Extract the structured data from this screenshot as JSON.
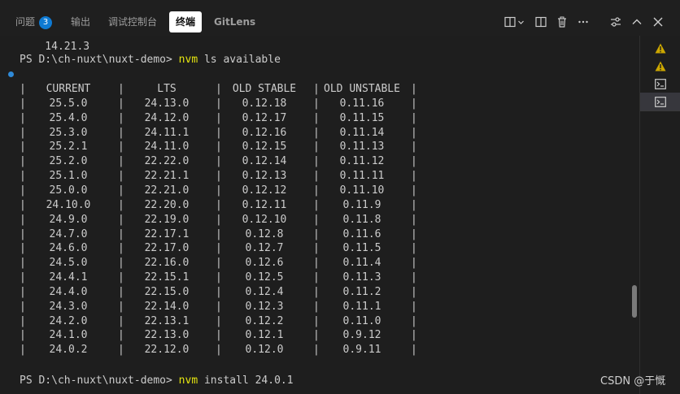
{
  "tabs": [
    {
      "label": "问题",
      "badge": "3"
    },
    {
      "label": "输出"
    },
    {
      "label": "调试控制台"
    },
    {
      "label": "终端",
      "active": true
    },
    {
      "label": "GitLens"
    }
  ],
  "toolbar_icons": [
    "split-terminal-icon",
    "chevron-down-icon",
    "layout-icon",
    "trash-icon",
    "more-icon",
    "settings-icon",
    "maximize-chevron-up-icon",
    "close-icon"
  ],
  "terminal": {
    "line_version": "    14.21.3",
    "prompt1": "PS D:\\ch-nuxt\\nuxt-demo> ",
    "cmd1": "nvm",
    "args1": " ls available",
    "prompt2": "PS D:\\ch-nuxt\\nuxt-demo> ",
    "cmd2": "nvm",
    "args2": " install 24.0.1"
  },
  "table": {
    "headers": [
      "CURRENT",
      "LTS",
      "OLD STABLE",
      "OLD UNSTABLE"
    ],
    "rows": [
      [
        "25.5.0",
        "24.13.0",
        "0.12.18",
        "0.11.16"
      ],
      [
        "25.4.0",
        "24.12.0",
        "0.12.17",
        "0.11.15"
      ],
      [
        "25.3.0",
        "24.11.1",
        "0.12.16",
        "0.11.14"
      ],
      [
        "25.2.1",
        "24.11.0",
        "0.12.15",
        "0.11.13"
      ],
      [
        "25.2.0",
        "22.22.0",
        "0.12.14",
        "0.11.12"
      ],
      [
        "25.1.0",
        "22.21.1",
        "0.12.13",
        "0.11.11"
      ],
      [
        "25.0.0",
        "22.21.0",
        "0.12.12",
        "0.11.10"
      ],
      [
        "24.10.0",
        "22.20.0",
        "0.12.11",
        "0.11.9"
      ],
      [
        "24.9.0",
        "22.19.0",
        "0.12.10",
        "0.11.8"
      ],
      [
        "24.7.0",
        "22.17.1",
        "0.12.8",
        "0.11.6"
      ],
      [
        "24.6.0",
        "22.17.0",
        "0.12.7",
        "0.11.5"
      ],
      [
        "24.5.0",
        "22.16.0",
        "0.12.6",
        "0.11.4"
      ],
      [
        "24.4.1",
        "22.15.1",
        "0.12.5",
        "0.11.3"
      ],
      [
        "24.4.0",
        "22.15.0",
        "0.12.4",
        "0.11.2"
      ],
      [
        "24.3.0",
        "22.14.0",
        "0.12.3",
        "0.11.1"
      ],
      [
        "24.2.0",
        "22.13.1",
        "0.12.2",
        "0.11.0"
      ],
      [
        "24.1.0",
        "22.13.0",
        "0.12.1",
        "0.9.12"
      ],
      [
        "24.0.2",
        "22.12.0",
        "0.12.0",
        "0.9.11"
      ]
    ]
  },
  "side_panel": {
    "items": [
      {
        "icon": "warning-icon",
        "color": "#cca700"
      },
      {
        "icon": "warning-icon",
        "color": "#cca700"
      },
      {
        "icon": "terminal-icon"
      },
      {
        "icon": "terminal-icon",
        "selected": true
      }
    ]
  },
  "watermark": "CSDN @于慨",
  "colors": {
    "background": "#1e1e1e",
    "command": "#e5e510",
    "text": "#cccccc",
    "badge": "#0e7ad3",
    "warning": "#cca700"
  }
}
